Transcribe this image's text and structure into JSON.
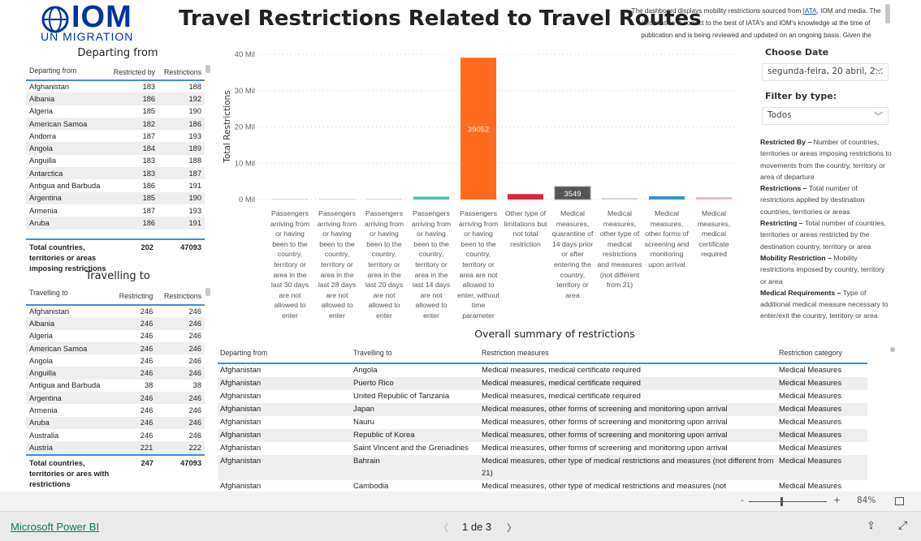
{
  "header": {
    "logo_text": "IOM",
    "logo_sub": "UN MIGRATION",
    "title": "Travel Restrictions Related to Travel Routes",
    "disclaimer_pre": "The dashboard displays mobility restrictions sourced from ",
    "disclaimer_link": "IATA",
    "disclaimer_post": ", IOM and media. The information is correct to the best of IATA's and IOM's knowledge at the time of publication and is being reviewed and updated on an ongoing basis. Given the"
  },
  "departing": {
    "title": "Departing from",
    "columns": [
      "Departing from",
      "Restricted by",
      "Restrictions"
    ],
    "rows": [
      [
        "Afghanistan",
        "183",
        "188"
      ],
      [
        "Albania",
        "186",
        "192"
      ],
      [
        "Algeria",
        "185",
        "190"
      ],
      [
        "American Samoa",
        "182",
        "186"
      ],
      [
        "Andorra",
        "187",
        "193"
      ],
      [
        "Angola",
        "184",
        "189"
      ],
      [
        "Anguilla",
        "183",
        "188"
      ],
      [
        "Antarctica",
        "183",
        "187"
      ],
      [
        "Antigua and Barbuda",
        "186",
        "191"
      ],
      [
        "Argentina",
        "185",
        "190"
      ],
      [
        "Armenia",
        "187",
        "193"
      ],
      [
        "Aruba",
        "186",
        "191"
      ]
    ],
    "total": [
      "Total countries, territories or areas imposing restrictions",
      "202",
      "47093"
    ]
  },
  "travelling": {
    "title": "Travelling to",
    "columns": [
      "Travelling to",
      "Restricting",
      "Restrictions"
    ],
    "rows": [
      [
        "Afghanistan",
        "246",
        "246"
      ],
      [
        "Albania",
        "246",
        "246"
      ],
      [
        "Algeria",
        "246",
        "246"
      ],
      [
        "American Samoa",
        "246",
        "246"
      ],
      [
        "Angola",
        "246",
        "246"
      ],
      [
        "Anguilla",
        "246",
        "246"
      ],
      [
        "Antigua and Barbuda",
        "38",
        "38"
      ],
      [
        "Argentina",
        "246",
        "246"
      ],
      [
        "Armenia",
        "246",
        "246"
      ],
      [
        "Aruba",
        "246",
        "246"
      ],
      [
        "Australia",
        "246",
        "246"
      ],
      [
        "Austria",
        "221",
        "222"
      ]
    ],
    "total": [
      "Total countries, territories or ares with restrictions",
      "247",
      "47093"
    ]
  },
  "chart_data": {
    "type": "bar",
    "ylabel": "Total Restrictions",
    "ylim": [
      0,
      40000
    ],
    "yticks": [
      "0 Mil",
      "10 Mil",
      "20 Mil",
      "30 Mil",
      "40 Mil"
    ],
    "grid": true,
    "categories": [
      "Passengers arriving from or having been to the country, territory or area in the last 30 days are not allowed to enter",
      "Passengers arriving from or having been to the country, territory or area in the last 28 days are not allowed to enter",
      "Passengers arriving from or having been to the country, territory or area in the last 20 days are not allowed to enter",
      "Passengers arriving from or having been to the country, territory or area in the last 14 days are not allowed to enter",
      "Passengers arriving from or having been to the country, territory or area are not allowed to enter, without time parameter",
      "Other type of limitations but not total restriction",
      "Medical measures, quarantine of 14 days prior or after entering the country, territory or area",
      "Medical measures, other type of medical restrictions and measures (not different from 21)",
      "Medical measures, other forms of screening and monitoring upon arrival",
      "Medical measures, medical certificate required"
    ],
    "values": [
      80,
      60,
      0,
      800,
      39052,
      1500,
      3549,
      400,
      900,
      700
    ],
    "data_labels": [
      "",
      "",
      "",
      "",
      "39052",
      "",
      "3549",
      "",
      "",
      ""
    ],
    "colors": [
      "#c9d6ea",
      "#c9d6ea",
      "#c9d6ea",
      "#5bb8b0",
      "#ff6a1e",
      "#d7263d",
      "#555555",
      "#d0d0d0",
      "#3498c0",
      "#e6c2c6"
    ]
  },
  "filters": {
    "date_label": "Choose Date",
    "date_value": "segunda-feira, 20 abril, 2...",
    "type_label": "Filter by type:",
    "type_value": "Todos"
  },
  "glossary": [
    [
      "Restricted By – ",
      "Number of countries, territories or areas imposing restrictions to movements from the country, territory or area of departure"
    ],
    [
      "Restrictions – ",
      "Total number of restrictions applied by destination countries, territories or areas"
    ],
    [
      "Restricting – ",
      "Total number of countries, territories or areas restricted by the destination country, territory or area"
    ],
    [
      "Mobility Restriction – ",
      "Mobility restrictions imposed by country, territory or area"
    ],
    [
      "Medical Requirements – ",
      "Type of additional medical measure necessary to enter/exit the country, territory or area"
    ]
  ],
  "summary": {
    "title": "Overall summary of restrictions",
    "columns": [
      "Departing from",
      "Travelling to",
      "Restriction measures",
      "Restriction category"
    ],
    "rows": [
      [
        "Afghanistan",
        "Angola",
        "Medical measures, medical certificate required",
        "Medical Measures"
      ],
      [
        "Afghanistan",
        "Puerto Rico",
        "Medical measures, medical certificate required",
        "Medical Measures"
      ],
      [
        "Afghanistan",
        "United Republic of Tanzania",
        "Medical measures, medical certificate required",
        "Medical Measures"
      ],
      [
        "Afghanistan",
        "Japan",
        "Medical measures, other forms of screening and monitoring upon arrival",
        "Medical Measures"
      ],
      [
        "Afghanistan",
        "Nauru",
        "Medical measures, other forms of screening and monitoring upon arrival",
        "Medical Measures"
      ],
      [
        "Afghanistan",
        "Republic of Korea",
        "Medical measures, other forms of screening and monitoring upon arrival",
        "Medical Measures"
      ],
      [
        "Afghanistan",
        "Saint Vincent and the Grenadines",
        "Medical measures, other forms of screening and monitoring upon arrival",
        "Medical Measures"
      ],
      [
        "Afghanistan",
        "Bahrain",
        "Medical measures, other type of medical restrictions and measures (not different from 21)",
        "Medical Measures"
      ],
      [
        "Afghanistan",
        "Cambodia",
        "Medical measures, other type of medical restrictions and measures (not",
        "Medical Measures"
      ]
    ]
  },
  "zoom": {
    "minus": "-",
    "plus": "+",
    "value": "84%"
  },
  "footer": {
    "brand": "Microsoft Power BI",
    "page": "1 de 3",
    "prev": "〈",
    "next": "〉"
  }
}
